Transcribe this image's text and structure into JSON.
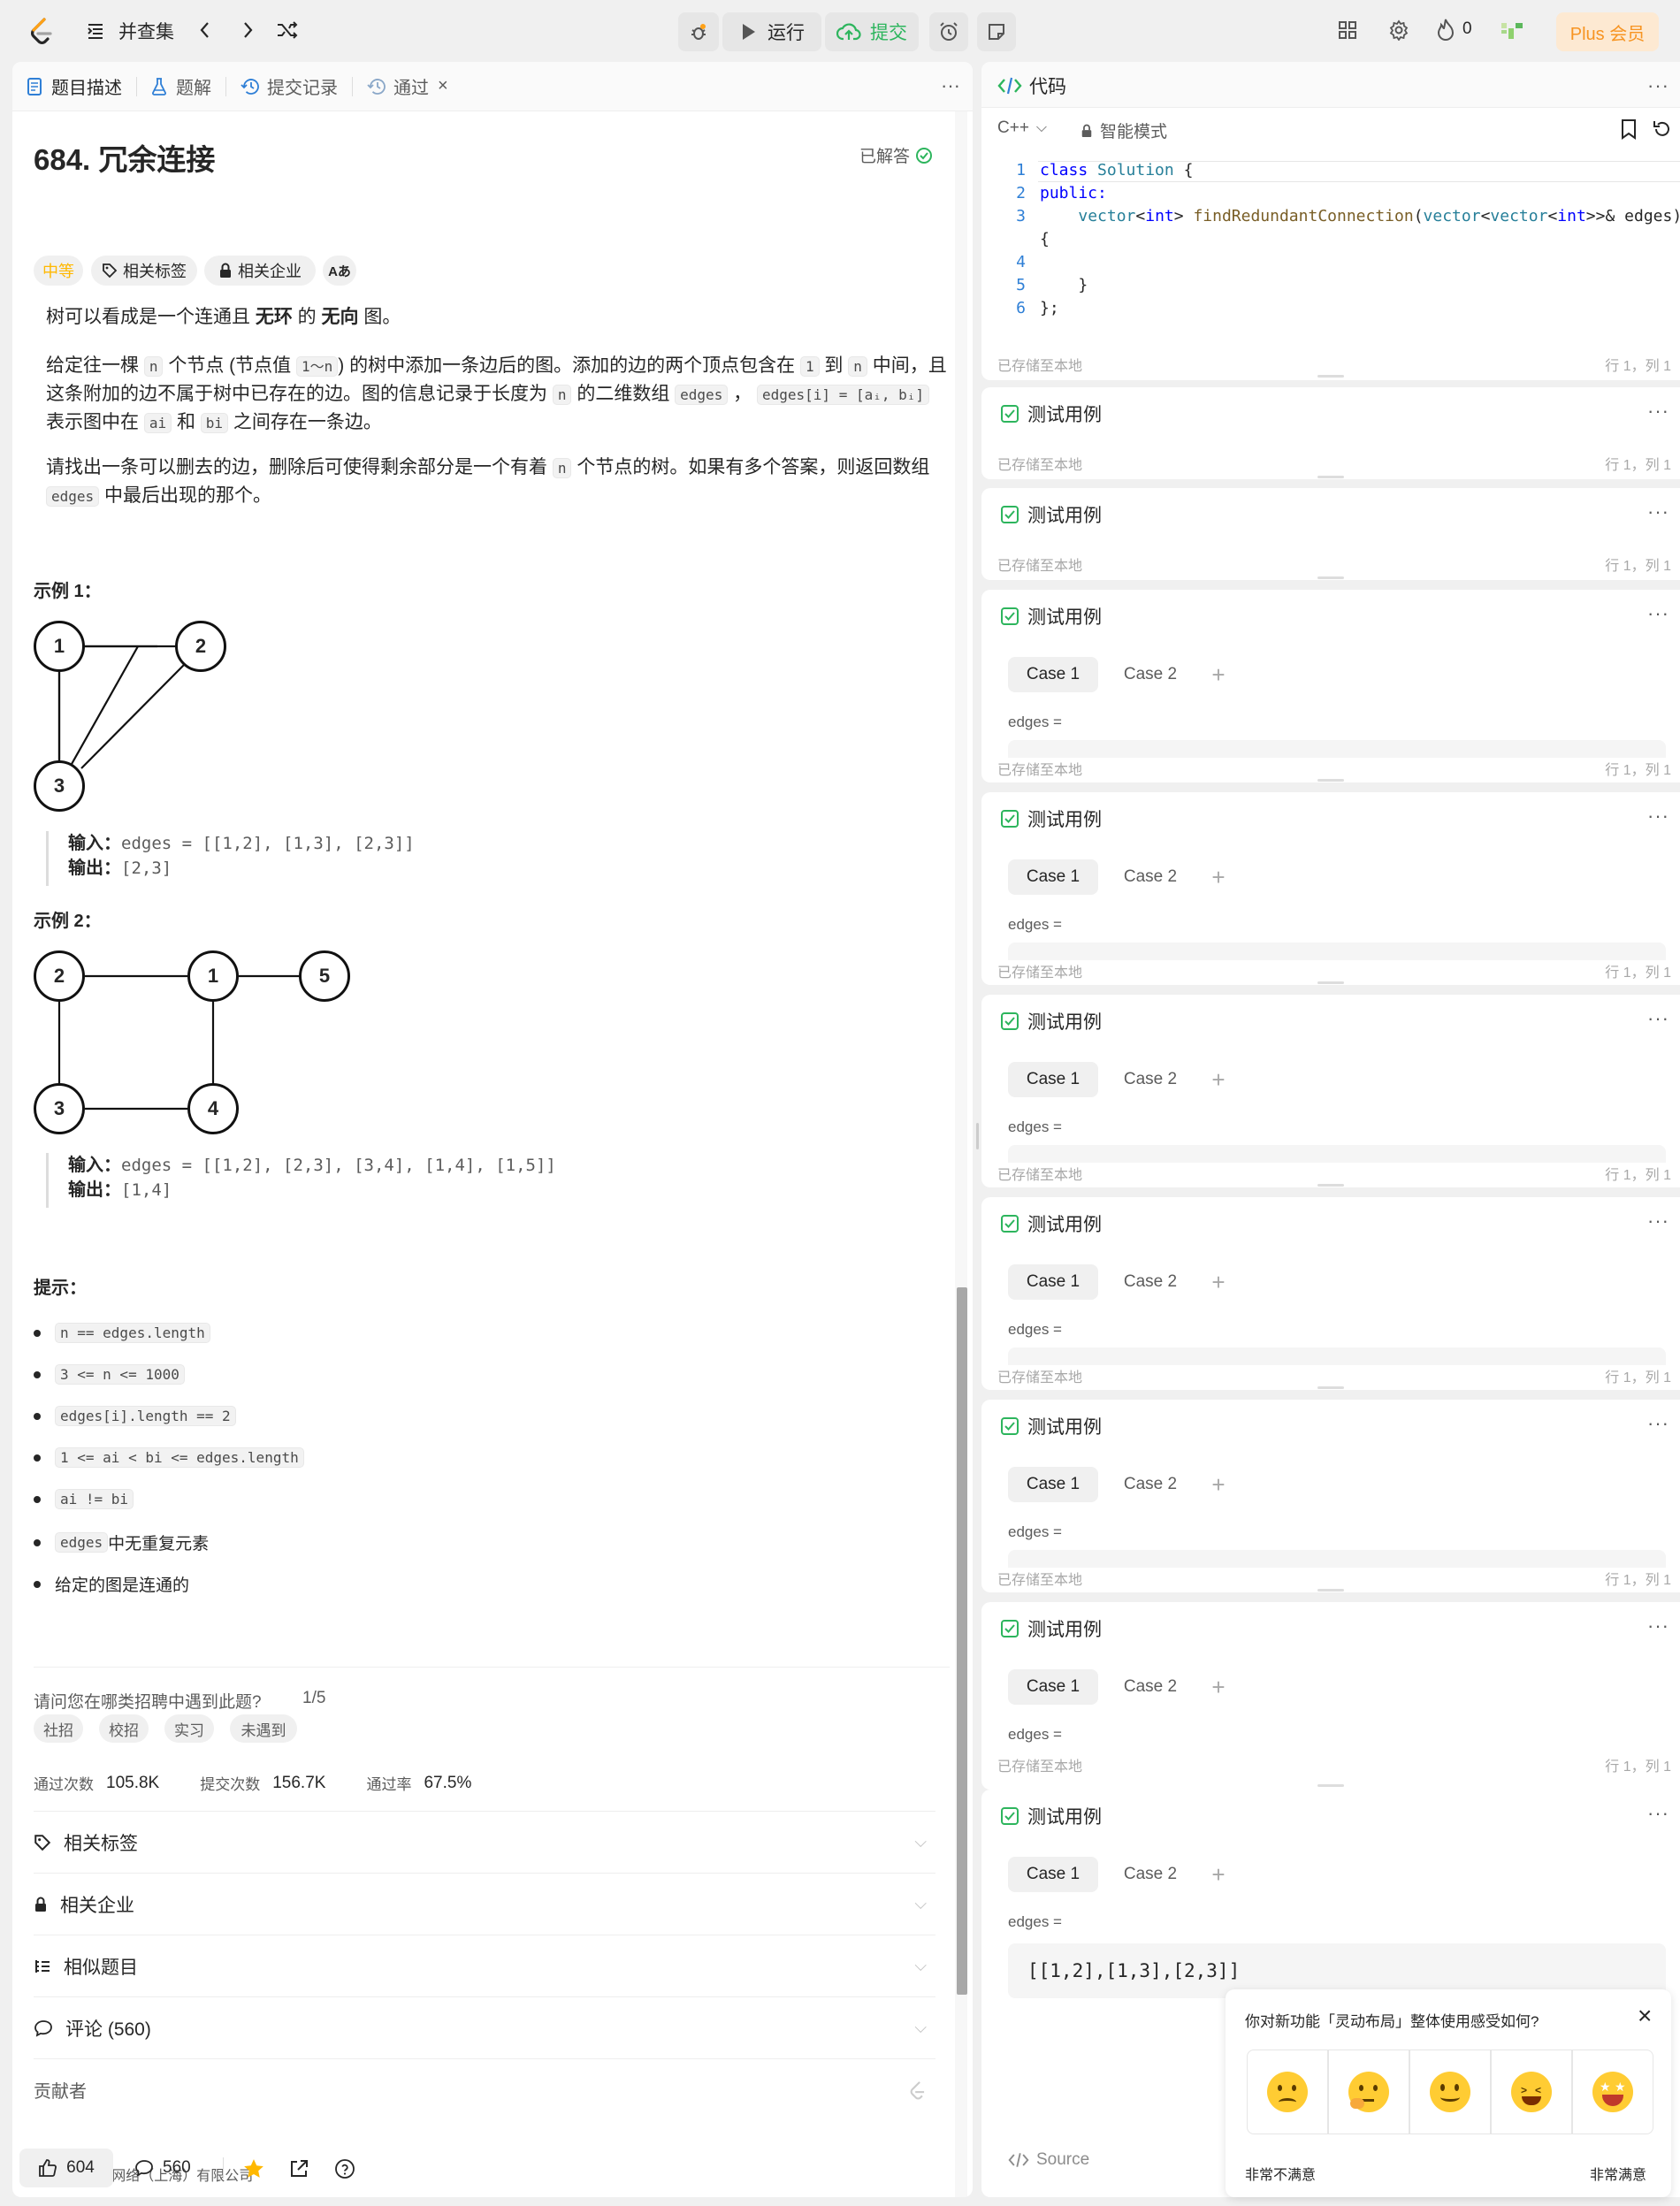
{
  "topbar": {
    "problem_list": "并查集",
    "run_label": "运行",
    "submit_label": "提交",
    "streak_count": "0",
    "plus_label": "Plus 会员"
  },
  "left_tabs": {
    "description": "题目描述",
    "solutions": "题解",
    "submissions": "提交记录",
    "accepted": "通过"
  },
  "problem": {
    "title": "684. 冗余连接",
    "solved_status": "已解答",
    "difficulty": "中等",
    "tag_topics": "相关标签",
    "tag_companies": "相关企业",
    "tag_translate": "Aあ",
    "p1_a": "树可以看成是一个连通且 ",
    "p1_b": "无环",
    "p1_c": " 的 ",
    "p1_d": "无向",
    "p1_e": " 图。",
    "p2_a": "给定往一棵 ",
    "p2_n": "n",
    "p2_b": " 个节点 (节点值 ",
    "p2_range": "1～n",
    "p2_c": ") 的树中添加一条边后的图。添加的边的两个顶点包含在 ",
    "p2_one": "1",
    "p2_d": " 到 ",
    "p2_n2": "n",
    "p2_e": " 中间，且这条附加的边不属于树中已存在的边。图的信息记录于长度为 ",
    "p2_n3": "n",
    "p2_f": " 的二维数组 ",
    "p2_edges": "edges",
    "p2_g": " ， ",
    "p2_edgei": "edges[i] = [aᵢ, bᵢ]",
    "p2_h": " 表示图中在 ",
    "p2_ai": "ai",
    "p2_i": " 和 ",
    "p2_bi": "bi",
    "p2_j": " 之间存在一条边。",
    "p3_a": "请找出一条可以删去的边，删除后可使得剩余部分是一个有着 ",
    "p3_n": "n",
    "p3_b": " 个节点的树。如果有多个答案，则返回数组 ",
    "p3_edges": "edges",
    "p3_c": " 中最后出现的那个。"
  },
  "example1": {
    "heading": "示例 1：",
    "nodes": [
      "1",
      "2",
      "3"
    ],
    "input_label": "输入：",
    "input_value": "edges = [[1,2], [1,3], [2,3]]",
    "output_label": "输出：",
    "output_value": "[2,3]"
  },
  "example2": {
    "heading": "示例 2：",
    "nodes": [
      "2",
      "1",
      "5",
      "3",
      "4"
    ],
    "input_label": "输入：",
    "input_value": "edges = [[1,2], [2,3], [3,4], [1,4], [1,5]]",
    "output_label": "输出：",
    "output_value": "[1,4]"
  },
  "constraints": {
    "heading": "提示：",
    "items": [
      "n == edges.length",
      "3 <= n <= 1000",
      "edges[i].length == 2",
      "1 <= ai < bi <= edges.length",
      "ai != bi"
    ],
    "item6_code": "edges",
    "item6_text": " 中无重复元素",
    "item7_text": "给定的图是连通的"
  },
  "survey": {
    "question": "请问您在哪类招聘中遇到此题?",
    "progress": "1/5",
    "options": [
      "社招",
      "校招",
      "实习",
      "未遇到"
    ]
  },
  "stats": {
    "accepted_label": "通过次数",
    "accepted_value": "105.8K",
    "submissions_label": "提交次数",
    "submissions_value": "156.7K",
    "rate_label": "通过率",
    "rate_value": "67.5%"
  },
  "accordion": {
    "topics": "相关标签",
    "companies": "相关企业",
    "similar": "相似题目",
    "discussion": "评论 (560)",
    "contributors": "贡献者"
  },
  "footer": {
    "copyright": "© 2023 领扣网络（上海）有限公司",
    "likes": "604",
    "comments": "560"
  },
  "code_panel": {
    "title": "代码",
    "language": "C++",
    "mode": "智能模式",
    "lines": [
      {
        "n": "1",
        "text": "class Solution {"
      },
      {
        "n": "2",
        "text": "public:"
      },
      {
        "n": "3",
        "text": "    vector<int> findRedundantConnection(vector<vector<int>>& edges)"
      },
      {
        "n": "",
        "text": "{"
      },
      {
        "n": "4",
        "text": ""
      },
      {
        "n": "5",
        "text": "    }"
      },
      {
        "n": "6",
        "text": "};"
      }
    ],
    "saved": "已存储至本地",
    "cursor": "行 1，列 1"
  },
  "testcase": {
    "title": "测试用例",
    "case1": "Case 1",
    "case2": "Case 2",
    "param": "edges =",
    "value": "[[1,2],[1,3],[2,3]]",
    "saved": "已存储至本地",
    "cursor": "行 1，列 1",
    "source": "Source"
  },
  "feedback": {
    "question": "你对新功能「灵动布局」整体使用感受如何?",
    "low": "非常不满意",
    "high": "非常满意"
  }
}
